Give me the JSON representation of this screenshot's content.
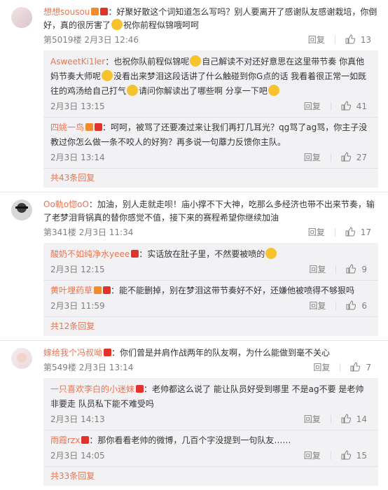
{
  "threads": [
    {
      "user": "想想sousou",
      "text_a": "：好聚好散这个词知道怎么写吗？别人要离开了感谢队友感谢栽培，你倒好，真的很厉害了",
      "text_b": "祝你前程似锦哦呵呵",
      "meta": "第5019楼 2月3日 12:46",
      "reply_label": "回复",
      "likes": "13",
      "replies": [
        {
          "user": "AsweetKi1ler",
          "text_a": "：也祝你队前程似锦呢",
          "text_b": "自己解读不对还好意思在这里带节奏 你真他妈节奏大师呢",
          "text_c": "没看出来梦泪这段话讲了什么触碰到你G点的话 我看着很正常一如既往的鸡汤给自己打气",
          "text_d": "请问你解读出了哪些啊 分享一下吧",
          "time": "2月3日 13:15",
          "reply_label": "回复",
          "likes": "41"
        },
        {
          "user": "四姚一鸟",
          "text_a": "：呵呵，被骂了还要凑过来让我们再打几耳光？qg骂了ag骂，你主子没教过你怎么做一条不咬人的好狗？再多说一句蘼力反馈你主队。",
          "time": "2月3日 13:14",
          "reply_label": "回复",
          "likes": "27"
        }
      ],
      "more": "共43条回复"
    },
    {
      "user": "Oo軌o惚oO",
      "text_a": "：加油，别人走就走呗！庙小撑不下大神，吃那么多经济也带不出来节奏，输了老梦泪背锅真的替你感觉不值，接下来的赛程希望你继续加油",
      "meta": "第341楼 2月3日 11:34",
      "reply_label": "回复",
      "likes": "17",
      "replies": [
        {
          "user": "酸奶不如纯净水yeee",
          "text_a": "：实话放在肚子里，不然要被喷的",
          "time": "2月3日 12:15",
          "reply_label": "回复",
          "likes": "9"
        },
        {
          "user": "黄叶埋药草",
          "text_a": "：能不能删掉，别在梦泪这带节奏好不好，还嫌他被喷得不够狠吗",
          "time": "2月3日 11:59",
          "reply_label": "回复",
          "likes": "6"
        }
      ],
      "more": "共12条回复"
    },
    {
      "user": "嫁给我个冯叔呦",
      "text_a": "：你们曾是并肩作战两年的队友啊，为什么能做到毫不关心",
      "meta": "第549楼 2月3日 13:14",
      "reply_label": "回复",
      "likes": "7",
      "replies": [
        {
          "user": "一只喜欢李白的小迷妹",
          "text_a": "：老帅都这么说了 能让队员好受到哪里 不是ag不要 是老帅非要走 队员私下能不难受吗",
          "time": "2月3日 14:13",
          "reply_label": "回复",
          "likes": "14"
        },
        {
          "user": "雨霞rzx",
          "text_a": "：那你看看老帅的微博，几百个字没提到一句队友……",
          "time": "2月3日 14:05",
          "reply_label": "回复",
          "likes": "15"
        }
      ],
      "more": "共33条回复"
    }
  ]
}
